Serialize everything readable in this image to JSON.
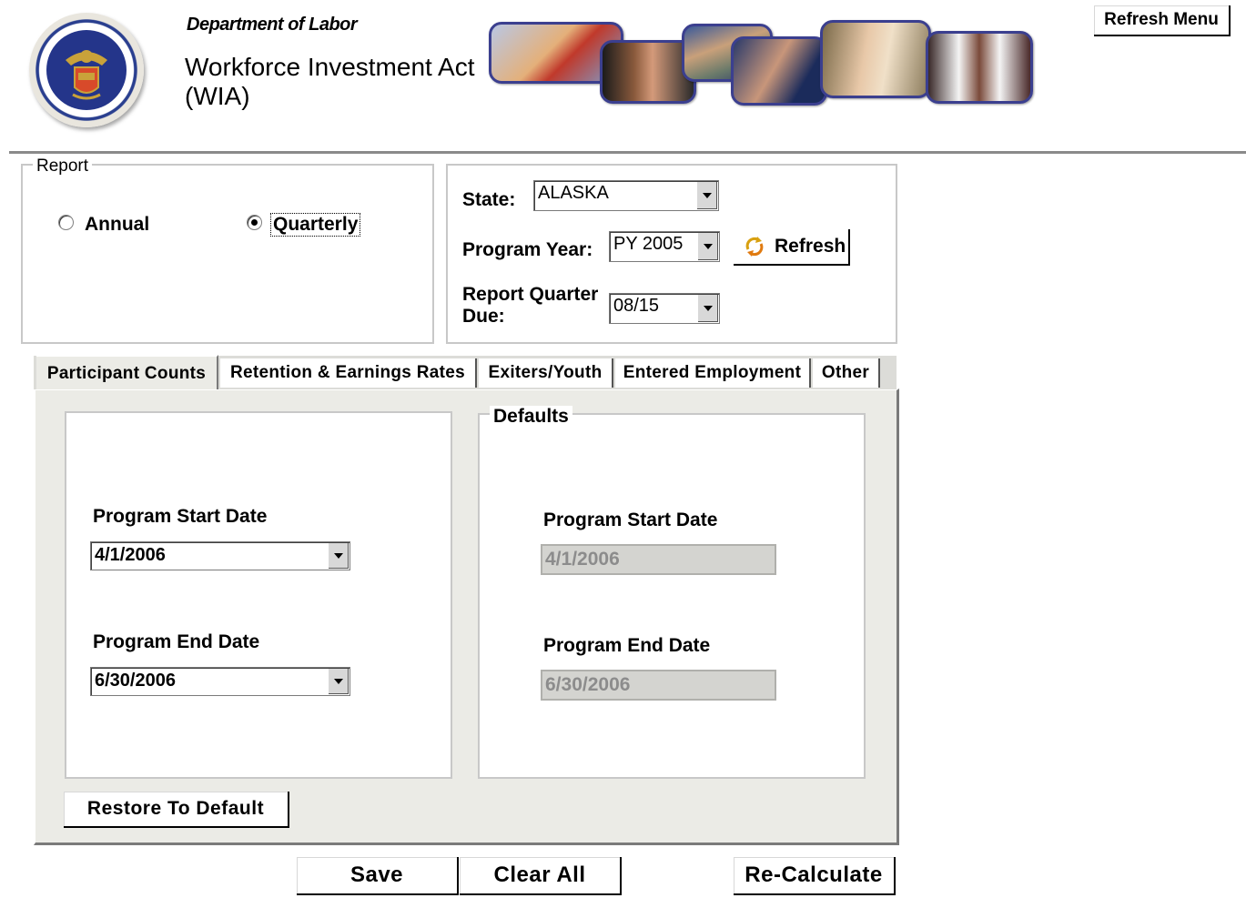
{
  "header": {
    "department": "Department of Labor",
    "app_title": "Workforce Investment Act (WIA)",
    "refresh_menu_label": "Refresh Menu"
  },
  "report": {
    "legend": "Report",
    "options": [
      {
        "label": "Annual",
        "selected": false
      },
      {
        "label": "Quarterly",
        "selected": true
      }
    ]
  },
  "selection": {
    "state_label": "State:",
    "state_value": "ALASKA",
    "program_year_label": "Program Year:",
    "program_year_value": "PY 2005",
    "refresh_label": "Refresh",
    "quarter_label_line1": "Report Quarter",
    "quarter_label_line2": "Due:",
    "quarter_value": "08/15"
  },
  "tabs": [
    {
      "label": "Participant Counts",
      "active": true
    },
    {
      "label": "Retention & Earnings Rates",
      "active": false
    },
    {
      "label": "Exiters/Youth",
      "active": false
    },
    {
      "label": "Entered Employment",
      "active": false
    },
    {
      "label": "Other",
      "active": false
    }
  ],
  "dates": {
    "start_label": "Program Start Date",
    "start_value": "4/1/2006",
    "end_label": "Program End Date",
    "end_value": "6/30/2006"
  },
  "defaults": {
    "legend": "Defaults",
    "start_label": "Program Start Date",
    "start_value": "4/1/2006",
    "end_label": "Program End Date",
    "end_value": "6/30/2006"
  },
  "actions": {
    "restore_label": "Restore To Default",
    "save_label": "Save",
    "clear_label": "Clear All",
    "recalc_label": "Re-Calculate"
  },
  "colors": {
    "accent_blue": "#2a3f8f",
    "panel_bg": "#ebebe6",
    "disabled_bg": "#d4d4d0"
  }
}
